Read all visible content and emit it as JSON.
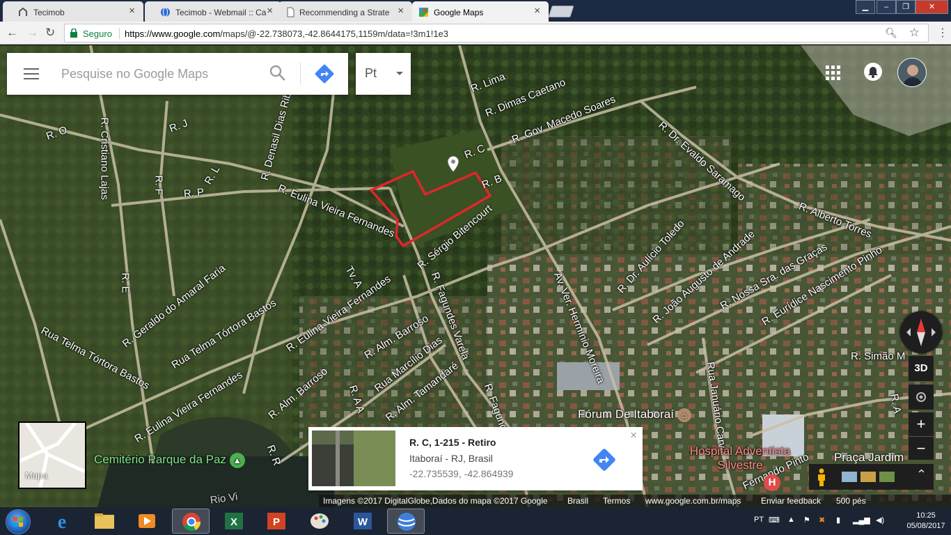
{
  "browser": {
    "tabs": [
      {
        "title": "Tecimob",
        "icon": "tecimob-icon"
      },
      {
        "title": "Tecimob - Webmail :: Ca",
        "icon": "globe-icon"
      },
      {
        "title": "Recommending a Strate",
        "icon": "document-icon"
      },
      {
        "title": "Google Maps",
        "icon": "google-maps-icon"
      }
    ],
    "secure_label": "Seguro",
    "url_host": "https://www.google.com",
    "url_path": "/maps/@-22.738073,-42.8644175,1159m/data=!3m1!1e3",
    "window_controls": {
      "minimize": "▁",
      "restore": "❐",
      "close": "✕"
    }
  },
  "maps": {
    "search_placeholder": "Pesquise no Google Maps",
    "lang_label": "Pt",
    "button_3d": "3D",
    "zoom_in": "+",
    "zoom_out": "−",
    "minimap_label": "Mapa",
    "place_card": {
      "title": "R. C, 1-215 - Retiro",
      "subtitle": "Itaboraí - RJ, Brasil",
      "coordinates": "-22.735539, -42.864939",
      "close": "×"
    },
    "street_labels": [
      "R. Lima",
      "R. Dimas Caetano",
      "R. Gov. Macedo Soares",
      "R. Dr. Evaldo Saramago",
      "R. C",
      "R. B",
      "R. O",
      "R. Cristiano Lajas",
      "R. J",
      "R. F",
      "R. P",
      "R. L",
      "R. Denasil Dias Rib",
      "R. Eulina Vieira Fernandes",
      "R. Alberto Torres",
      "R. Sérgio Bitencourt",
      "R. E",
      "R. Geraldo do Amaral Faria",
      "Tv. A",
      "R. Fagundes Varela",
      "Av. Ver. Hermínio Moreira",
      "R. Dr. Aulício Toledo",
      "R. João Augusto de Andrade",
      "R. Nossa Sra. das Graças",
      "R. Eurídice Nascimento Pinho",
      "Rua Telma Tórtora Bastos",
      "R. Eulina Vieira Fernandes",
      "R. Alm. Barroso",
      "Rua Marcílio Dias",
      "Rua Telma Tórtora Bastos",
      "R. Eulina Vieira Fernandes",
      "R. Alm. Barroso",
      "R. A A",
      "R. Alm. Tamandaré",
      "R. Fagund",
      "Rua Januário Carv",
      "R. Simão M",
      "R. A",
      "R. R",
      "Rio Vi",
      "Fernando Pinto"
    ],
    "poi": {
      "forum": "Fórum De Itaboraí",
      "hospital": "Hospital Adventista Silvestre",
      "cemetery": "Cemitério Parque da Paz",
      "praca": "Praça Jardim"
    },
    "footer": {
      "imagery": "Imagens ©2017 DigitalGlobe,Dados do mapa ©2017 Google",
      "country": "Brasil",
      "terms": "Termos",
      "domain": "www.google.com.br/maps",
      "feedback": "Enviar feedback",
      "scale": "500 pés"
    }
  },
  "taskbar": {
    "lang": "PT",
    "time": "10:25",
    "date": "05/08/2017",
    "apps": [
      "windows-explorer-icon",
      "internet-explorer-icon",
      "file-explorer-icon",
      "media-player-icon",
      "chrome-icon",
      "excel-icon",
      "powerpoint-icon",
      "paint-icon",
      "word-icon",
      "google-earth-icon"
    ]
  },
  "colors": {
    "parcel_outline": "#e0262b",
    "direction_blue": "#4285f4",
    "secure_green": "#0b8043",
    "cemetery_green": "#7ee787",
    "hospital_red": "#ff8a8a"
  }
}
